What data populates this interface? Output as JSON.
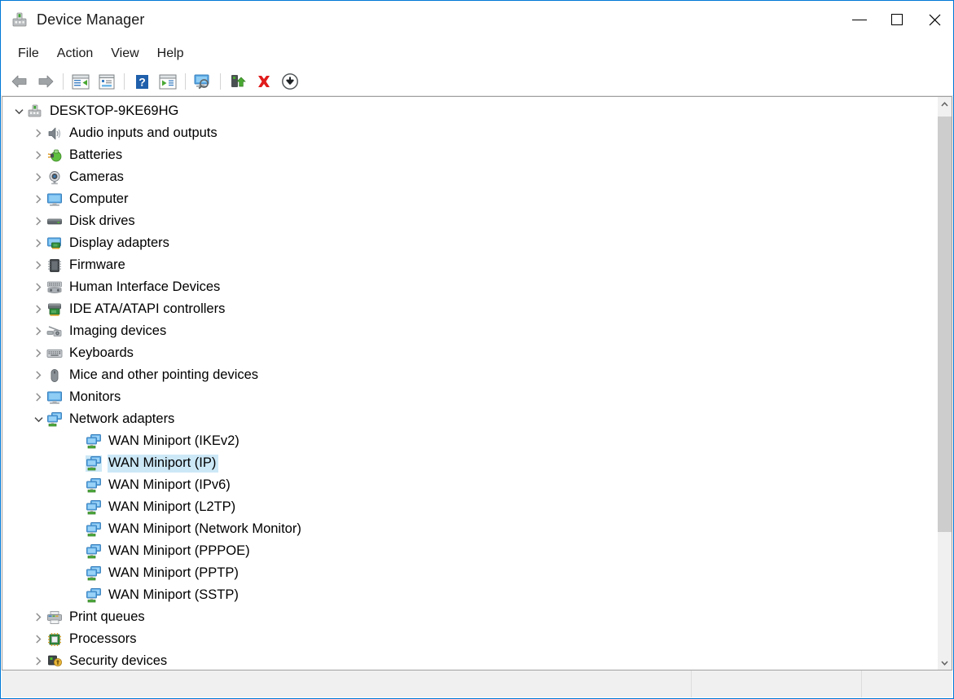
{
  "window": {
    "title": "Device Manager",
    "icon": "device-manager-icon",
    "accent_color": "#0078d7",
    "selection_color": "#cce8f7"
  },
  "titlebar_buttons": [
    {
      "name": "minimize",
      "glyph": "minimize-icon"
    },
    {
      "name": "maximize",
      "glyph": "maximize-icon"
    },
    {
      "name": "close",
      "glyph": "close-icon"
    }
  ],
  "menubar": {
    "items": [
      {
        "label": "File"
      },
      {
        "label": "Action"
      },
      {
        "label": "View"
      },
      {
        "label": "Help"
      }
    ]
  },
  "toolbar": {
    "items": [
      {
        "name": "back-icon",
        "tooltip": "Back"
      },
      {
        "name": "forward-icon",
        "tooltip": "Forward"
      },
      {
        "name": "separator"
      },
      {
        "name": "show-hide-console-tree-icon",
        "tooltip": "Show/Hide Console Tree"
      },
      {
        "name": "properties-icon",
        "tooltip": "Properties"
      },
      {
        "name": "separator"
      },
      {
        "name": "help-icon",
        "tooltip": "Help"
      },
      {
        "name": "update-driver-icon",
        "tooltip": "Update Driver Software"
      },
      {
        "name": "separator"
      },
      {
        "name": "scan-for-hardware-changes-icon",
        "tooltip": "Scan for hardware changes"
      },
      {
        "name": "separator"
      },
      {
        "name": "update-driver-software-icon",
        "tooltip": "Update Driver Software"
      },
      {
        "name": "uninstall-device-icon",
        "tooltip": "Uninstall device"
      },
      {
        "name": "disable-device-icon",
        "tooltip": "Disable device"
      }
    ]
  },
  "tree": {
    "rows": [
      {
        "depth": 0,
        "label": "DESKTOP-9KE69HG",
        "icon": "computer-root-icon",
        "expander": "expanded",
        "selected": false
      },
      {
        "depth": 1,
        "label": "Audio inputs and outputs",
        "icon": "speaker-icon",
        "expander": "collapsed",
        "selected": false
      },
      {
        "depth": 1,
        "label": "Batteries",
        "icon": "battery-icon",
        "expander": "collapsed",
        "selected": false
      },
      {
        "depth": 1,
        "label": "Cameras",
        "icon": "camera-icon",
        "expander": "collapsed",
        "selected": false
      },
      {
        "depth": 1,
        "label": "Computer",
        "icon": "monitor-icon",
        "expander": "collapsed",
        "selected": false
      },
      {
        "depth": 1,
        "label": "Disk drives",
        "icon": "disk-drive-icon",
        "expander": "collapsed",
        "selected": false
      },
      {
        "depth": 1,
        "label": "Display adapters",
        "icon": "display-adapter-icon",
        "expander": "collapsed",
        "selected": false
      },
      {
        "depth": 1,
        "label": "Firmware",
        "icon": "firmware-chip-icon",
        "expander": "collapsed",
        "selected": false
      },
      {
        "depth": 1,
        "label": "Human Interface Devices",
        "icon": "hid-icon",
        "expander": "collapsed",
        "selected": false
      },
      {
        "depth": 1,
        "label": "IDE ATA/ATAPI controllers",
        "icon": "ide-controller-icon",
        "expander": "collapsed",
        "selected": false
      },
      {
        "depth": 1,
        "label": "Imaging devices",
        "icon": "imaging-device-icon",
        "expander": "collapsed",
        "selected": false
      },
      {
        "depth": 1,
        "label": "Keyboards",
        "icon": "keyboard-icon",
        "expander": "collapsed",
        "selected": false
      },
      {
        "depth": 1,
        "label": "Mice and other pointing devices",
        "icon": "mouse-icon",
        "expander": "collapsed",
        "selected": false
      },
      {
        "depth": 1,
        "label": "Monitors",
        "icon": "monitor-icon",
        "expander": "collapsed",
        "selected": false
      },
      {
        "depth": 1,
        "label": "Network adapters",
        "icon": "network-adapter-icon",
        "expander": "expanded",
        "selected": false
      },
      {
        "depth": 2,
        "label": "WAN Miniport (IKEv2)",
        "icon": "network-adapter-icon",
        "expander": "none",
        "selected": false
      },
      {
        "depth": 2,
        "label": "WAN Miniport (IP)",
        "icon": "network-adapter-icon",
        "expander": "none",
        "selected": true
      },
      {
        "depth": 2,
        "label": "WAN Miniport (IPv6)",
        "icon": "network-adapter-icon",
        "expander": "none",
        "selected": false
      },
      {
        "depth": 2,
        "label": "WAN Miniport (L2TP)",
        "icon": "network-adapter-icon",
        "expander": "none",
        "selected": false
      },
      {
        "depth": 2,
        "label": "WAN Miniport (Network Monitor)",
        "icon": "network-adapter-icon",
        "expander": "none",
        "selected": false
      },
      {
        "depth": 2,
        "label": "WAN Miniport (PPPOE)",
        "icon": "network-adapter-icon",
        "expander": "none",
        "selected": false
      },
      {
        "depth": 2,
        "label": "WAN Miniport (PPTP)",
        "icon": "network-adapter-icon",
        "expander": "none",
        "selected": false
      },
      {
        "depth": 2,
        "label": "WAN Miniport (SSTP)",
        "icon": "network-adapter-icon",
        "expander": "none",
        "selected": false
      },
      {
        "depth": 1,
        "label": "Print queues",
        "icon": "printer-icon",
        "expander": "collapsed",
        "selected": false
      },
      {
        "depth": 1,
        "label": "Processors",
        "icon": "processor-icon",
        "expander": "collapsed",
        "selected": false
      },
      {
        "depth": 1,
        "label": "Security devices",
        "icon": "security-device-icon",
        "expander": "collapsed",
        "selected": false
      }
    ]
  },
  "statusbar": {
    "panes": [
      {
        "text": ""
      },
      {
        "text": ""
      },
      {
        "text": ""
      }
    ]
  }
}
